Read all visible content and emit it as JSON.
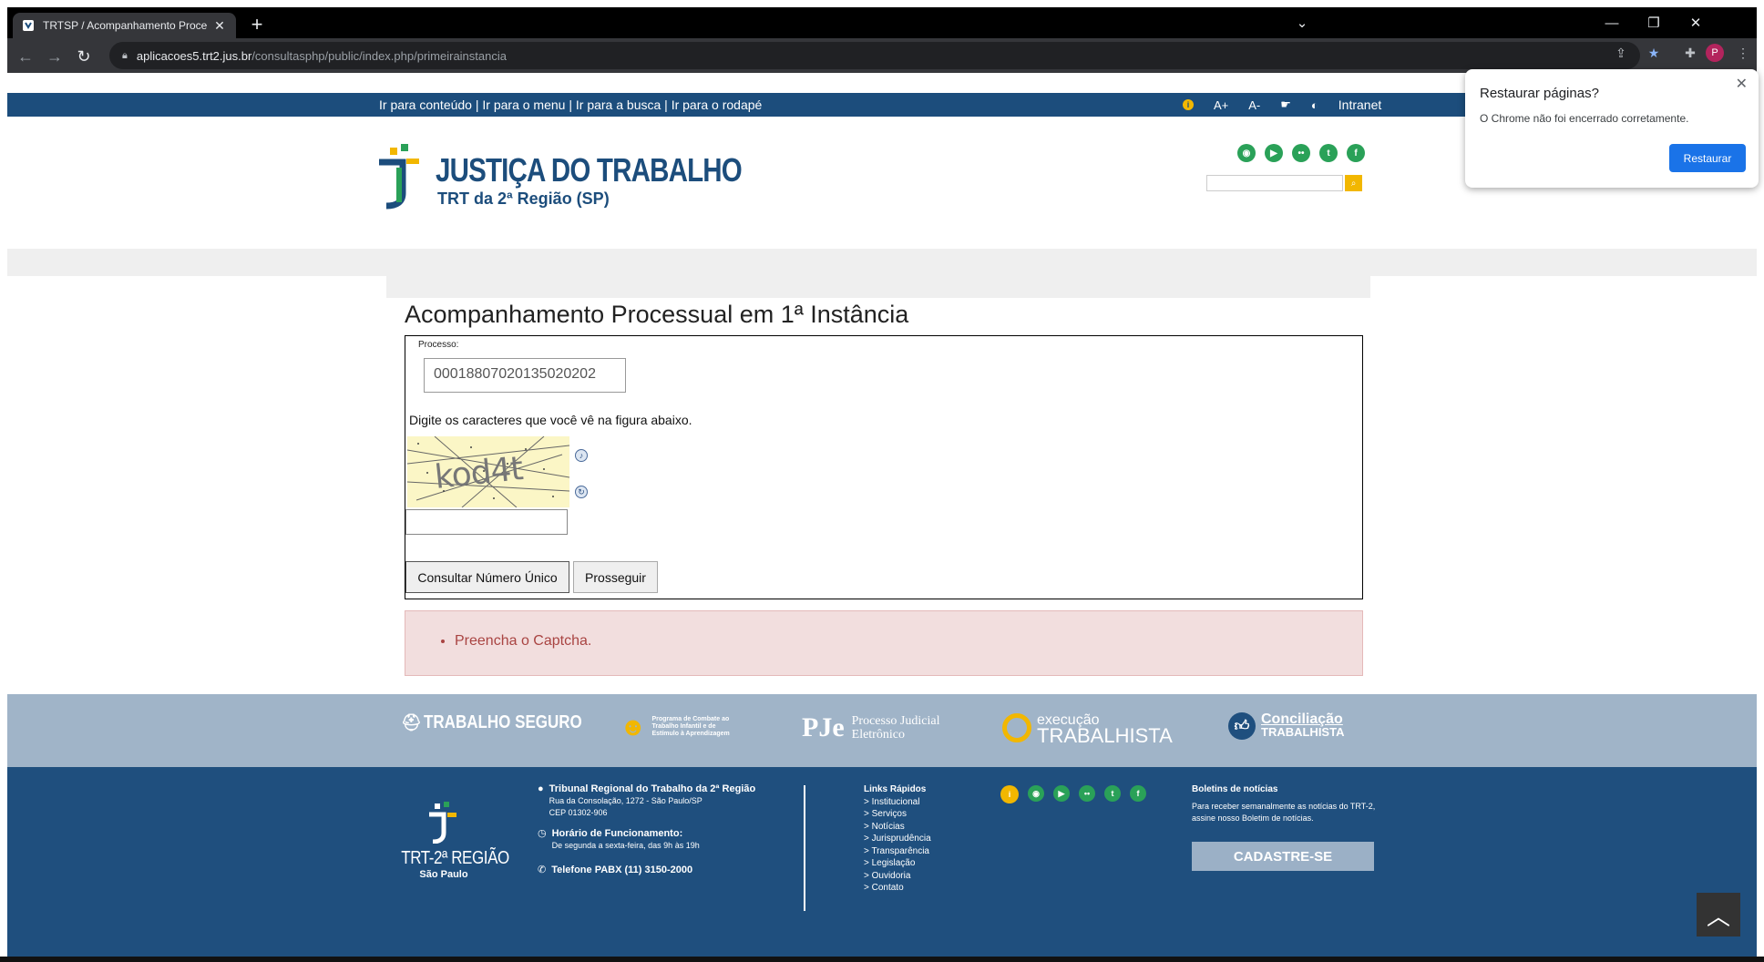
{
  "browser": {
    "tab_title": "TRTSP / Acompanhamento Proce",
    "new_tab": "+",
    "url_host": "aplicacoes5.trt2.jus.br",
    "url_path": "/consultasphp/public/index.php/primeirainstancia",
    "profile_letter": "P"
  },
  "accessibility": {
    "skip_content": "Ir para conteúdo",
    "skip_menu": "Ir para o menu",
    "skip_search": "Ir para a busca",
    "skip_footer": "Ir para o rodapé",
    "sep": " | ",
    "font_increase": "A+",
    "font_decrease": "A-",
    "intranet": "Intranet"
  },
  "header": {
    "logo_title": "JUSTIÇA DO TRABALHO",
    "logo_subtitle": "TRT da 2ª Região (SP)"
  },
  "main": {
    "title": "Acompanhamento Processual em 1ª Instância",
    "process_label": "Processo:",
    "process_value": "00018807020135020202",
    "captcha_hint": "Digite os caracteres que você vê na figura abaixo.",
    "captcha_text": "kod4t",
    "btn_consult": "Consultar Número Único",
    "btn_proceed": "Prosseguir",
    "error_message": "Preencha o Captcha."
  },
  "partners": {
    "p1": "TRABALHO SEGURO",
    "p2": "Programa de Combate ao Trabalho Infantil e de Estímulo à Aprendizagem",
    "p3_logo": "PJe",
    "p3_a": "Processo Judicial",
    "p3_b": "Eletrônico",
    "p4_a": "execução",
    "p4_b": "TRABALHISTA",
    "p5_a": "Conciliação",
    "p5_b": "TRABALHISTA"
  },
  "footer": {
    "logo_title": "TRT-2ª REGIÃO",
    "logo_sub": "São Paulo",
    "court_name": "Tribunal Regional do Trabalho da 2ª Região",
    "address": "Rua da Consolação, 1272 - São Paulo/SP",
    "cep": "CEP 01302-906",
    "hours_title": "Horário de Funcionamento:",
    "hours": "De segunda a sexta-feira, das 9h às 19h",
    "phone": "Telefone PABX (11) 3150-2000",
    "links_title": "Links Rápidos",
    "links": [
      "> Institucional",
      "> Serviços",
      "> Notícias",
      "> Jurisprudência",
      "> Transparência",
      "> Legislação",
      "> Ouvidoria",
      "> Contato"
    ],
    "newsletter_title": "Boletins de notícias",
    "newsletter_text": "Para receber semanalmente as notícias do TRT-2, assine nosso Boletim de notícias.",
    "newsletter_button": "CADASTRE-SE"
  },
  "popup": {
    "title": "Restaurar páginas?",
    "message": "O Chrome não foi encerrado corretamente.",
    "button": "Restaurar"
  },
  "colors": {
    "brand_blue": "#1c4d7c",
    "accent_yellow": "#f2b700",
    "social_green": "#2aa158",
    "error_bg": "#f2dede",
    "chrome_blue": "#1a73e8"
  }
}
